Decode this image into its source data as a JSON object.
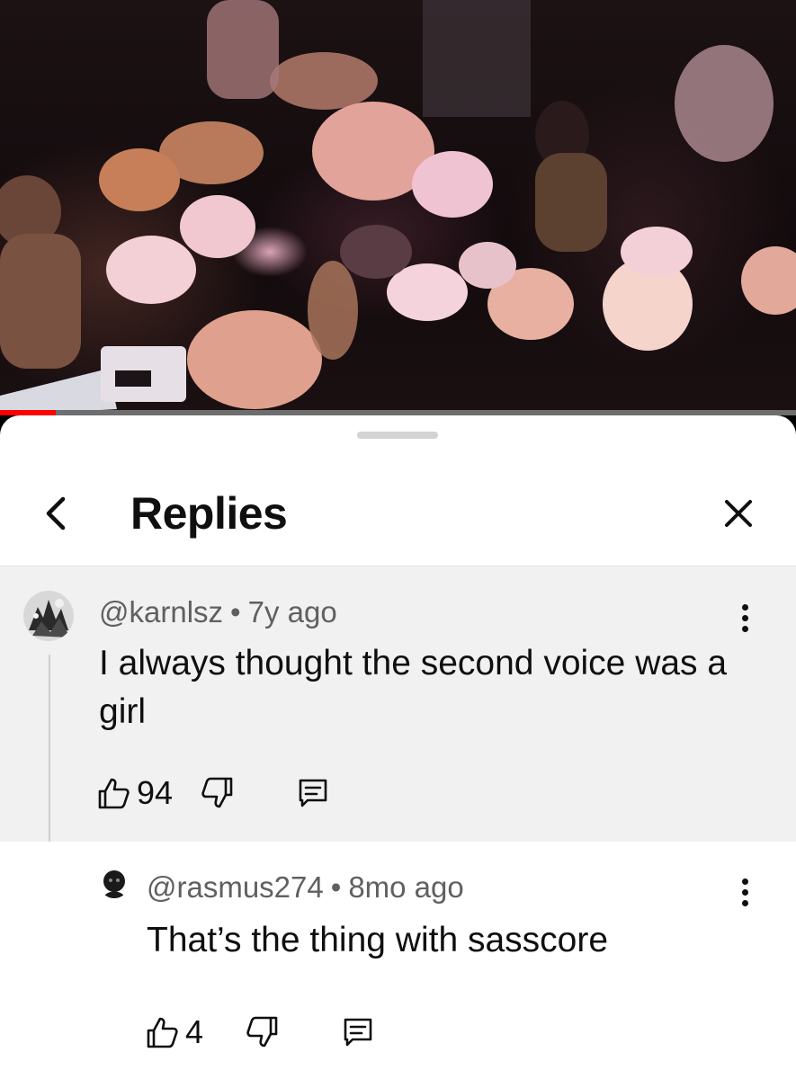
{
  "video": {
    "progress_fraction": 0.07,
    "progress_color": "#ff0000"
  },
  "header": {
    "back_icon": "chevron-left-icon",
    "title": "Replies",
    "close_icon": "close-icon"
  },
  "comments": [
    {
      "handle": "@karnlsz",
      "separator": "•",
      "age": "7y ago",
      "text": "I always thought the second voice was a girl",
      "likes": "94",
      "like_icon": "thumbs-up-icon",
      "dislike_icon": "thumbs-down-icon",
      "reply_icon": "reply-comment-icon",
      "menu_icon": "more-vert-icon"
    },
    {
      "handle": "@rasmus274",
      "separator": "•",
      "age": "8mo ago",
      "text": "That’s the thing with sasscore",
      "likes": "4",
      "like_icon": "thumbs-up-icon",
      "dislike_icon": "thumbs-down-icon",
      "reply_icon": "reply-comment-icon",
      "menu_icon": "more-vert-icon"
    }
  ]
}
